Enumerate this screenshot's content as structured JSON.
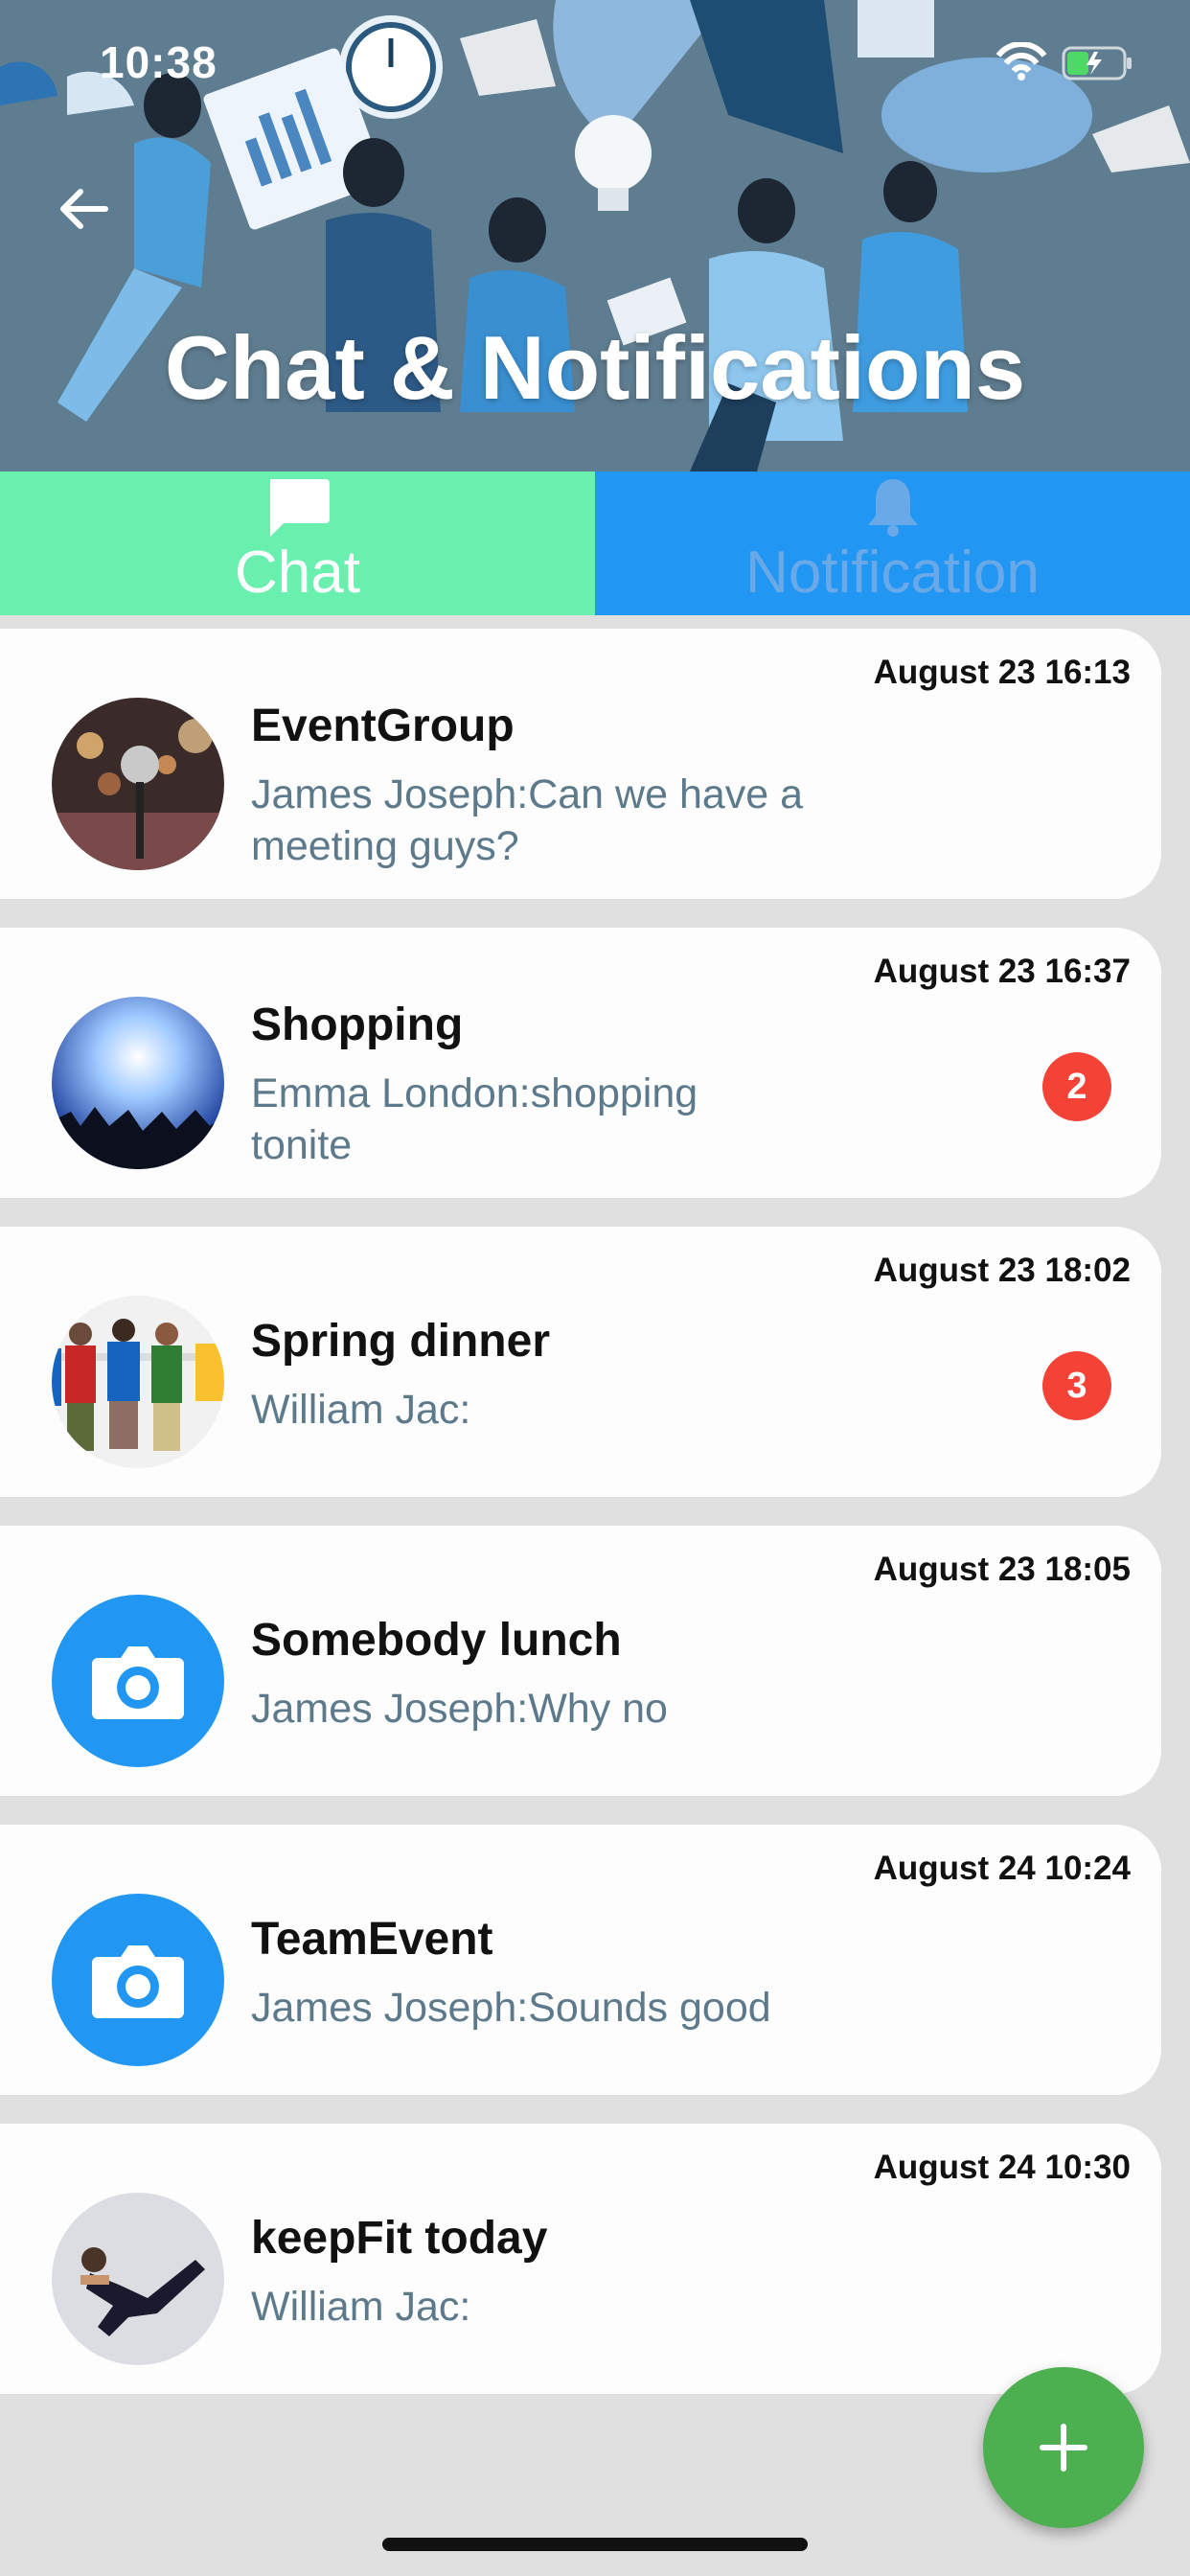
{
  "status_bar": {
    "time": "10:38"
  },
  "header": {
    "title": "Chat & Notifications"
  },
  "tabs": [
    {
      "label": "Chat",
      "icon": "chat-bubble-icon",
      "selected": true
    },
    {
      "label": "Notification",
      "icon": "bell-icon",
      "selected": false
    }
  ],
  "colors": {
    "chat_tab": "#69f0ae",
    "notification_tab": "#2196f3",
    "badge": "#f44336",
    "fab": "#4caf50"
  },
  "chats": [
    {
      "title": "EventGroup",
      "message": "James Joseph:Can we have a meeting guys?",
      "time": "August 23 16:13",
      "avatar": "microphone-photo"
    },
    {
      "title": "Shopping",
      "message": "Emma London:shopping tonite",
      "time": "August 23 16:37",
      "badge": "2",
      "avatar": "concert-photo"
    },
    {
      "title": "Spring dinner",
      "message": "William Jac:",
      "time": "August 23 18:02",
      "badge": "3",
      "avatar": "people-photo"
    },
    {
      "title": "Somebody lunch",
      "message": "James Joseph:Why no",
      "time": "August 23 18:05",
      "avatar": "camera-icon"
    },
    {
      "title": "TeamEvent",
      "message": "James Joseph:Sounds good",
      "time": "August 24 10:24",
      "avatar": "camera-icon"
    },
    {
      "title": "keepFit today",
      "message": "William Jac:",
      "time": "August 24 10:30",
      "avatar": "fitness-photo"
    }
  ],
  "fab": {
    "icon": "plus-icon"
  }
}
